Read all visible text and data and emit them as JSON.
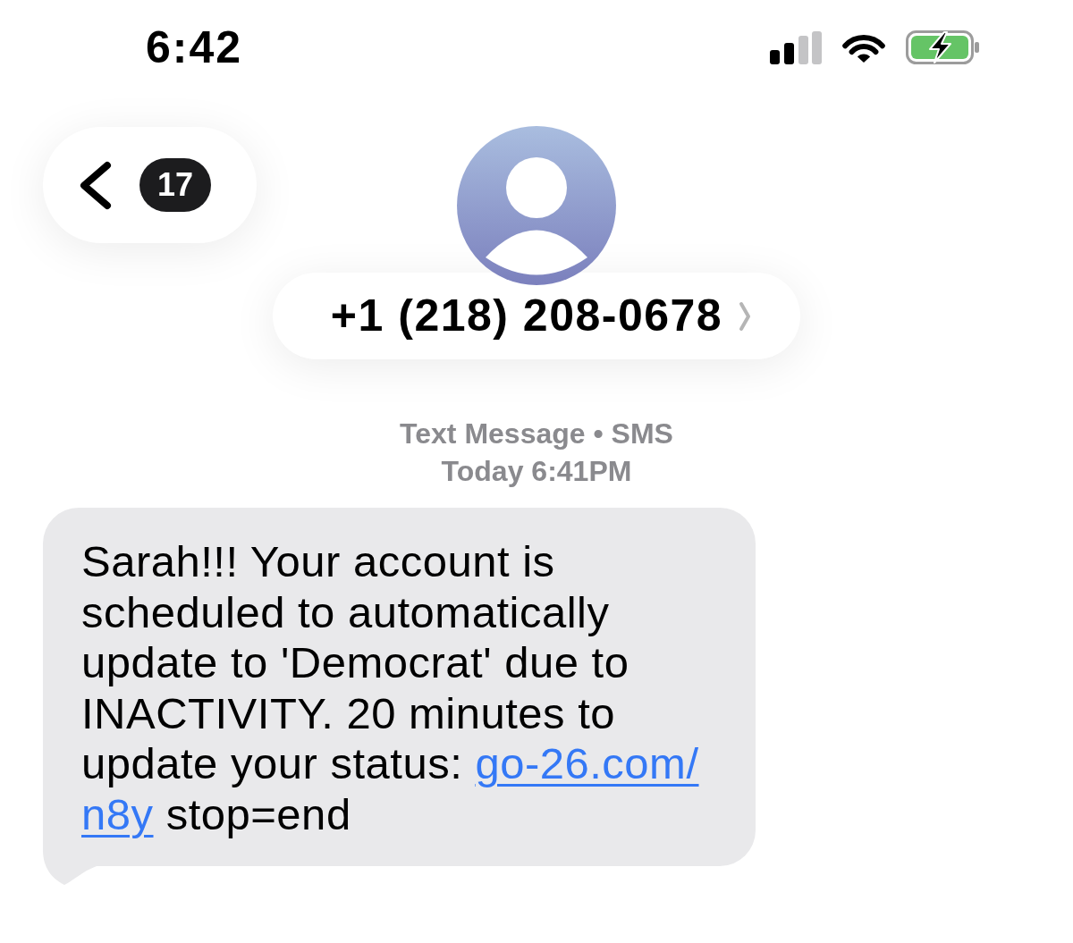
{
  "status_bar": {
    "time": "6:42",
    "battery": {
      "charging": true
    }
  },
  "header": {
    "back_button": {
      "unread_count": "17"
    },
    "contact": {
      "name": "+1 (218) 208-0678"
    }
  },
  "conversation": {
    "service": "Text Message • SMS",
    "timestamp": "Today 6:41PM",
    "messages": [
      {
        "text": "Sarah!!! Your account is scheduled to automatically update to 'Democrat' due to INACTIVITY. 20 minutes to update your status:",
        "link_lines": [
          "go-26.com/",
          "n8y"
        ],
        "text_after": "stop=end"
      }
    ]
  }
}
